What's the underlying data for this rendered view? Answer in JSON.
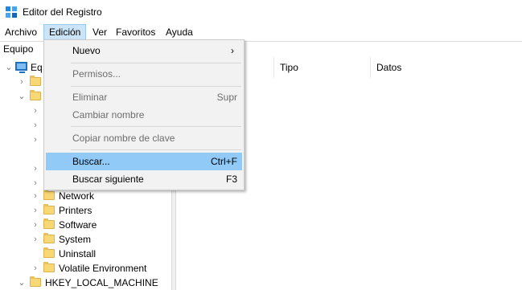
{
  "window": {
    "title": "Editor del Registro"
  },
  "menubar": {
    "items": [
      {
        "label": "Archivo"
      },
      {
        "label": "Edición"
      },
      {
        "label": "Ver"
      },
      {
        "label": "Favoritos"
      },
      {
        "label": "Ayuda"
      }
    ]
  },
  "address": {
    "path": "Equipo"
  },
  "tree": {
    "root_label": "Eq",
    "visible_items": [
      "Network",
      "Printers",
      "Software",
      "System",
      "Uninstall",
      "Volatile Environment"
    ],
    "hklm_label": "HKEY_LOCAL_MACHINE"
  },
  "list": {
    "columns": [
      "Tipo",
      "Datos"
    ]
  },
  "edit_menu": {
    "items": [
      {
        "label": "Nuevo",
        "shortcut": "›"
      },
      {
        "label": "Permisos..."
      },
      {
        "label": "Eliminar",
        "shortcut": "Supr"
      },
      {
        "label": "Cambiar nombre"
      },
      {
        "label": "Copiar nombre de clave"
      },
      {
        "label": "Buscar...",
        "shortcut": "Ctrl+F"
      },
      {
        "label": "Buscar siguiente",
        "shortcut": "F3"
      }
    ]
  },
  "colors": {
    "highlight": "#91c9f7",
    "menu_active": "#cce4f7",
    "folder": "#f8d775"
  }
}
